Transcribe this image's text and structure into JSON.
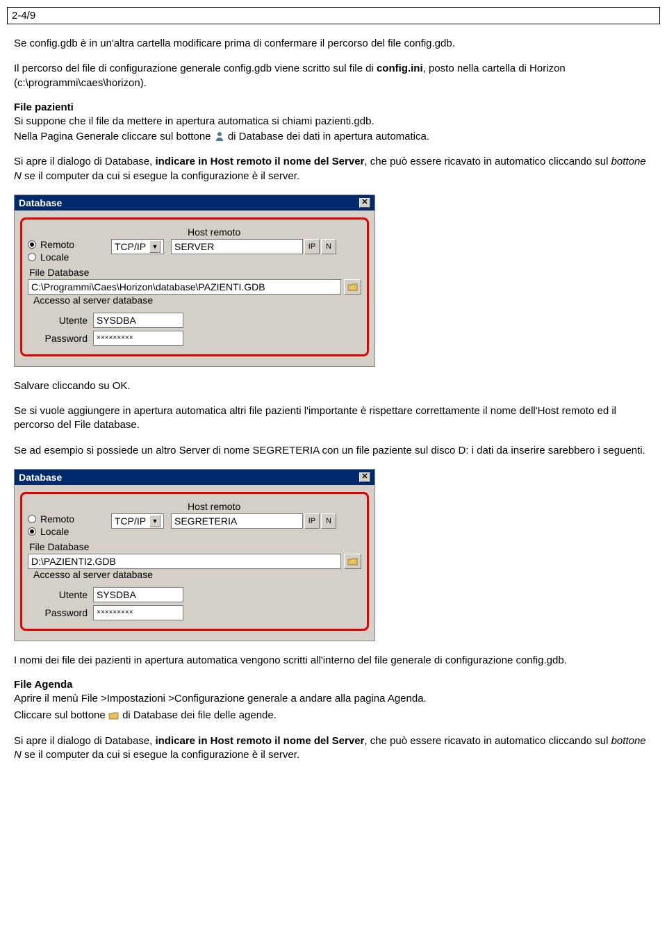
{
  "page_number": "2-4/9",
  "text": {
    "p1": "Se config.gdb è in un'altra cartella modificare prima di confermare il percorso del file config.gdb.",
    "p2a": "Il percorso del file di configurazione generale config.gdb viene scritto sul file di ",
    "p2b": "config.ini",
    "p2c": ", posto nella cartella di Horizon (c:\\programmi\\caes\\horizon).",
    "h_pazienti": "File pazienti",
    "p3": "Si suppone che il file da mettere in apertura automatica si chiami pazienti.gdb.",
    "p4a": "Nella Pagina Generale cliccare sul bottone ",
    "p4b": " di Database dei dati in apertura automatica.",
    "p5a": "Si apre il dialogo di Database, ",
    "p5b": "indicare in Host remoto il nome del Server",
    "p5c": ", che può essere ricavato in automatico cliccando sul ",
    "p5d": "bottone N",
    "p5e": " se il computer da cui si esegue la configurazione è il server.",
    "p6": "Salvare cliccando su OK.",
    "p7": "Se si vuole aggiungere in apertura automatica altri file pazienti l'importante è rispettare correttamente il nome dell'Host remoto ed il percorso del File database.",
    "p8": "Se ad esempio si possiede un altro Server di nome SEGRETERIA con un file paziente sul disco D: i dati da inserire sarebbero i seguenti.",
    "p9": "I nomi dei file dei pazienti in apertura automatica vengono scritti all'interno del file generale di configurazione config.gdb.",
    "h_agenda": "File Agenda",
    "p10": "Aprire il menù File >Impostazioni >Configurazione generale a andare alla pagina Agenda.",
    "p11a": "Cliccare sul bottone ",
    "p11b": " di Database dei file delle agende.",
    "p12a": "Si apre il dialogo di Database, ",
    "p12b": "indicare in Host remoto il nome del Server",
    "p12c": ", che può essere ricavato in automatico cliccando sul ",
    "p12d": "bottone N",
    "p12e": " se il computer da cui si esegue la configurazione è il server."
  },
  "dialog1": {
    "title": "Database",
    "remoto_label": "Remoto",
    "locale_label": "Locale",
    "remoto_checked": true,
    "locale_checked": false,
    "protocol": "TCP/IP",
    "host_label": "Host remoto",
    "host_value": "SERVER",
    "ip_btn": "IP",
    "n_btn": "N",
    "file_label": "File Database",
    "file_value": "C:\\Programmi\\Caes\\Horizon\\database\\PAZIENTI.GDB",
    "access_label": "Accesso al server database",
    "user_label": "Utente",
    "user_value": "SYSDBA",
    "pass_label": "Password",
    "pass_value": "×××××××××"
  },
  "dialog2": {
    "title": "Database",
    "remoto_label": "Remoto",
    "locale_label": "Locale",
    "remoto_checked": false,
    "locale_checked": true,
    "protocol": "TCP/IP",
    "host_label": "Host remoto",
    "host_value": "SEGRETERIA",
    "ip_btn": "IP",
    "n_btn": "N",
    "file_label": "File Database",
    "file_value": "D:\\PAZIENTI2.GDB",
    "access_label": "Accesso al server database",
    "user_label": "Utente",
    "user_value": "SYSDBA",
    "pass_label": "Password",
    "pass_value": "×××××××××"
  }
}
